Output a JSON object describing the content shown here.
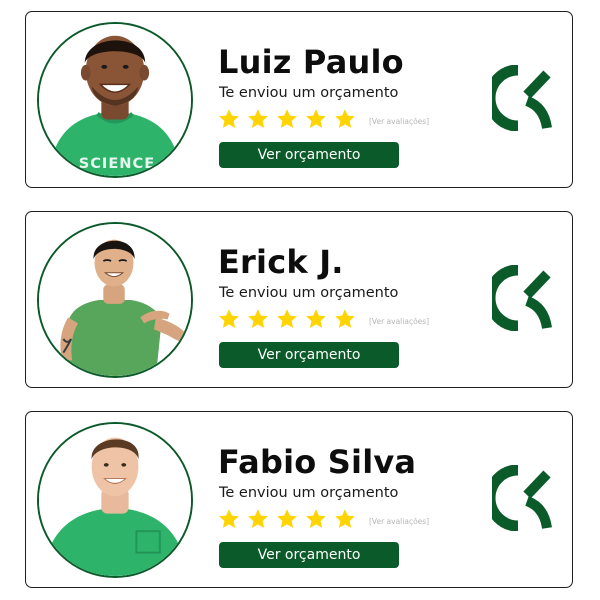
{
  "brand": {
    "accent_color": "#0b5a2a",
    "star_color": "#ffd400",
    "logo_icon": "brand-logo-icon"
  },
  "cards": [
    {
      "name": "Luiz Paulo",
      "subtitle": "Te enviou um orçamento",
      "rating": 5,
      "reviews_link": "[Ver avaliações]",
      "button_label": "Ver orçamento",
      "shirt_text": "SCIENCE"
    },
    {
      "name": "Erick J.",
      "subtitle": "Te enviou um orçamento",
      "rating": 5,
      "reviews_link": "[Ver avaliações]",
      "button_label": "Ver orçamento"
    },
    {
      "name": "Fabio Silva",
      "subtitle": "Te enviou um orçamento",
      "rating": 5,
      "reviews_link": "[Ver avaliações]",
      "button_label": "Ver orçamento"
    }
  ]
}
